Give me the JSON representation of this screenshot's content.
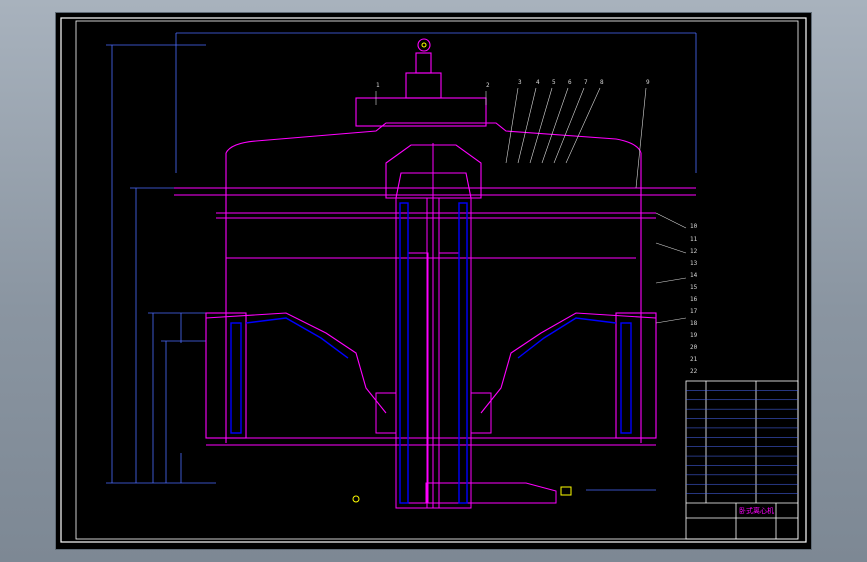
{
  "drawing": {
    "colors": {
      "background": "#000000",
      "frame": "#ffffff",
      "outline": "#ff00ff",
      "section": "#0000ff",
      "dimension": "#4d6dff",
      "leader": "#d8d8d8",
      "accent": "#ffff00"
    },
    "balloons": [
      "1",
      "2",
      "3",
      "4",
      "5",
      "6",
      "7",
      "8",
      "9",
      "10",
      "11",
      "12",
      "13",
      "14",
      "15",
      "16",
      "17",
      "18",
      "19",
      "20",
      "21",
      "22"
    ],
    "title_block": {
      "rows": 13,
      "title": "卧式离心机"
    }
  }
}
